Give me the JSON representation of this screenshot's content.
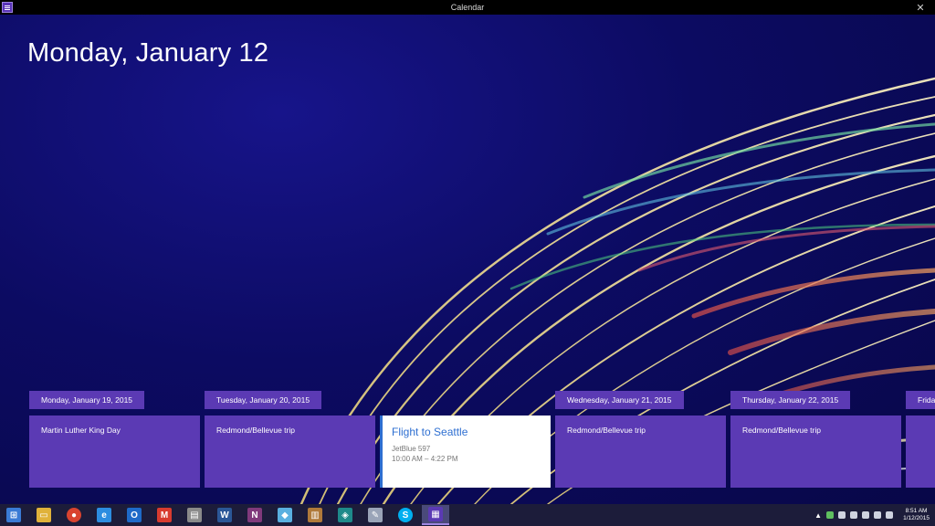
{
  "window": {
    "title": "Calendar",
    "close_glyph": "✕"
  },
  "main": {
    "date_heading": "Monday, January 12"
  },
  "agenda": [
    {
      "day": "Monday, January 19, 2015",
      "event": "Martin Luther King Day"
    },
    {
      "day": "Tuesday, January 20, 2015",
      "event": "Redmond/Bellevue trip"
    },
    {
      "day": "",
      "event": "Flight to Seattle",
      "details": [
        "JetBlue 597",
        "10:00 AM – 4:22 PM"
      ],
      "selected": true
    },
    {
      "day": "Wednesday, January 21, 2015",
      "event": "Redmond/Bellevue trip"
    },
    {
      "day": "Thursday, January 22, 2015",
      "event": "Redmond/Bellevue trip"
    },
    {
      "day": "Friday",
      "event": ""
    }
  ],
  "taskbar": {
    "items": [
      {
        "name": "start-button",
        "icon": "windows-logo-icon",
        "glyph": "⊞",
        "color": "#3a7bd5"
      },
      {
        "name": "file-explorer-button",
        "icon": "folder-icon",
        "glyph": "▭",
        "color": "#e0b23a"
      },
      {
        "name": "chrome-button",
        "icon": "chrome-icon",
        "glyph": "●",
        "color": "#d9432f"
      },
      {
        "name": "internet-explorer-button",
        "icon": "ie-icon",
        "glyph": "e",
        "color": "#2c8de0"
      },
      {
        "name": "outlook-button",
        "icon": "outlook-icon",
        "glyph": "O",
        "color": "#1e6ac8"
      },
      {
        "name": "gmail-button",
        "icon": "mail-icon",
        "glyph": "M",
        "color": "#d83b2f"
      },
      {
        "name": "news-button",
        "icon": "news-icon",
        "glyph": "▤",
        "color": "#8a8a8a"
      },
      {
        "name": "word-button",
        "icon": "word-icon",
        "glyph": "W",
        "color": "#2b5797"
      },
      {
        "name": "onenote-button",
        "icon": "onenote-icon",
        "glyph": "N",
        "color": "#80397b"
      },
      {
        "name": "notes-button",
        "icon": "notes-icon",
        "glyph": "◆",
        "color": "#5ab0e0"
      },
      {
        "name": "library-button",
        "icon": "books-icon",
        "glyph": "▥",
        "color": "#b07a3a"
      },
      {
        "name": "app-button",
        "icon": "tile-app-icon",
        "glyph": "◈",
        "color": "#1e8a8a"
      },
      {
        "name": "paint-button",
        "icon": "paint-icon",
        "glyph": "✎",
        "color": "#9aa4b8"
      },
      {
        "name": "skype-button",
        "icon": "skype-icon",
        "glyph": "S",
        "color": "#00aff0"
      },
      {
        "name": "calendar-button",
        "icon": "calendar-icon",
        "glyph": "▦",
        "color": "#5b3ab4",
        "active": true
      }
    ],
    "clock": {
      "time": "8:51 AM",
      "date": "1/12/2015"
    }
  }
}
